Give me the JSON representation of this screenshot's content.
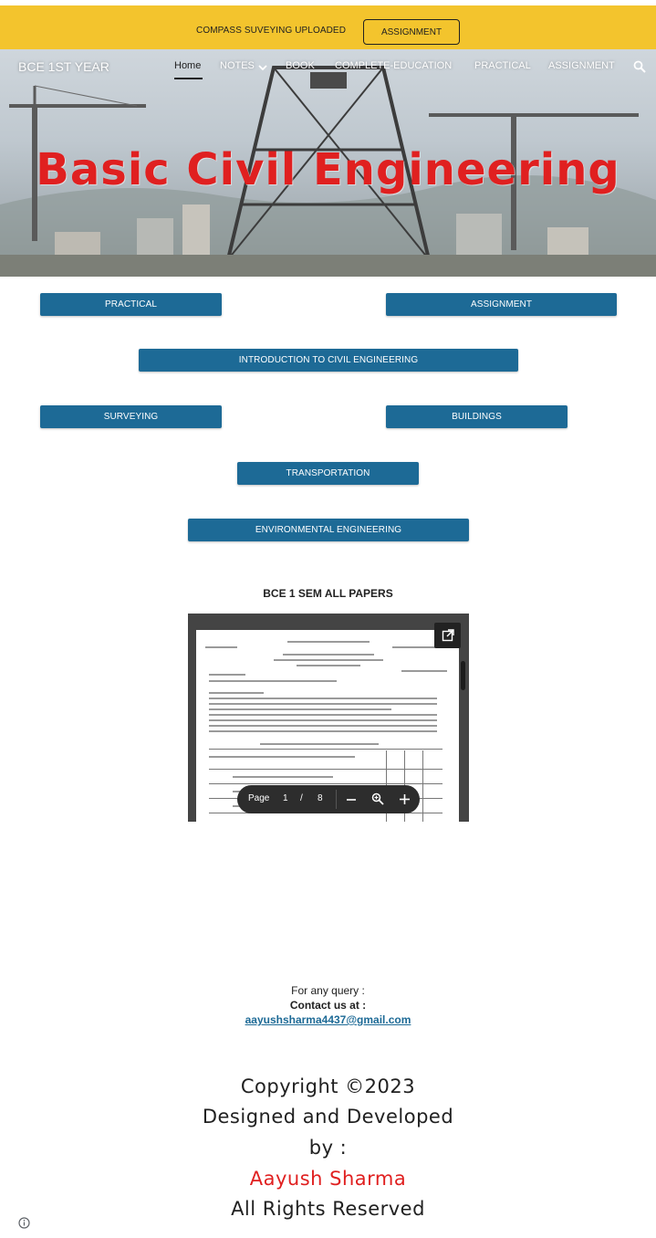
{
  "announcement": {
    "text": "COMPASS SUVEYING UPLOADED",
    "button_label": "ASSIGNMENT"
  },
  "site": {
    "title": "BCE 1ST YEAR"
  },
  "nav": {
    "items": [
      {
        "label": "Home"
      },
      {
        "label": "NOTES"
      },
      {
        "label": "BOOK"
      },
      {
        "label": "COMPLETE-EDUCATION"
      },
      {
        "label": "PRACTICAL"
      },
      {
        "label": "ASSIGNMENT"
      }
    ],
    "icons": [
      "chevron-down-icon",
      "search-icon"
    ]
  },
  "hero": {
    "title": "Basic Civil Engineering"
  },
  "buttons": {
    "practical": "PRACTICAL",
    "assignment": "ASSIGNMENT",
    "intro": "INTRODUCTION TO CIVIL ENGINEERING",
    "surveying": "SURVEYING",
    "buildings": "BUILDINGS",
    "transportation": "TRANSPORTATION",
    "environmental": "ENVIRONMENTAL ENGINEERING"
  },
  "papers": {
    "title": "BCE 1 SEM ALL PAPERS",
    "viewer": {
      "page_label": "Page",
      "current_page": "1",
      "separator": "/",
      "total_pages": "8"
    }
  },
  "contact": {
    "query": "For any query :",
    "contact_label": "Contact us at :",
    "email": "aayushsharma4437@gmail.com"
  },
  "footer": {
    "copyright": "Copyright  ©2023",
    "designed": "Designed and Developed",
    "by": "by :",
    "author": "Aayush Sharma",
    "rights": "All Rights Reserved"
  },
  "colors": {
    "announcement_bg": "#f3c42d",
    "button_bg": "#1d6a96",
    "hero_title": "#e02020",
    "author": "#e02020"
  }
}
